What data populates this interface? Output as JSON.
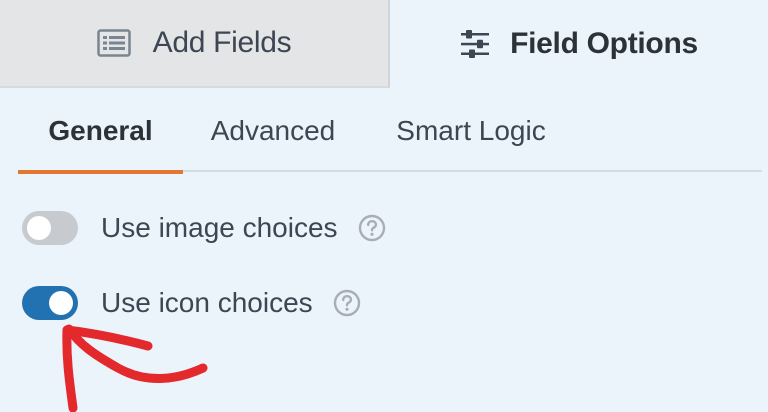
{
  "panel_tabs": {
    "add_fields": {
      "label": "Add Fields",
      "icon": "list-icon"
    },
    "field_options": {
      "label": "Field Options",
      "icon": "sliders-icon"
    }
  },
  "sub_tabs": [
    {
      "label": "General",
      "active": true
    },
    {
      "label": "Advanced",
      "active": false
    },
    {
      "label": "Smart Logic",
      "active": false
    }
  ],
  "options": [
    {
      "label": "Use image choices",
      "enabled": false,
      "help_icon": "question-icon"
    },
    {
      "label": "Use icon choices",
      "enabled": true,
      "help_icon": "question-icon"
    }
  ],
  "colors": {
    "accent_tab_underline": "#e27730",
    "toggle_on": "#2271b1",
    "toggle_off": "#c7cbd0",
    "annotation_arrow": "#e3292c",
    "panel_background": "#ebf3fb"
  }
}
